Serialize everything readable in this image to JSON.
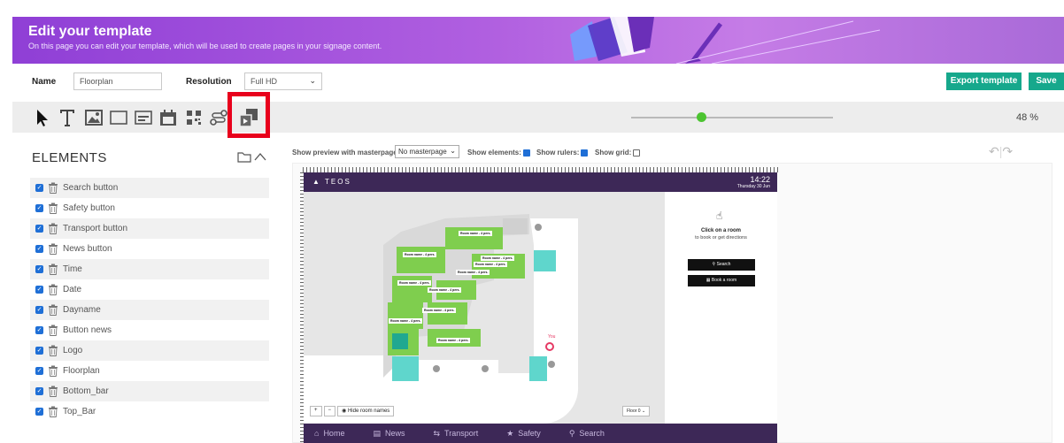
{
  "header": {
    "title": "Edit your template",
    "subtitle": "On this page you can edit your template, which will be used to create pages in your signage content."
  },
  "form": {
    "name_label": "Name",
    "name_value": "Floorplan",
    "resolution_label": "Resolution",
    "resolution_value": "Full HD"
  },
  "actions": {
    "export_label": "Export template",
    "save_label": "Save"
  },
  "toolbar": {
    "tools": [
      "pointer-icon",
      "text-icon",
      "image-icon",
      "rectangle-icon",
      "ticker-icon",
      "calendar-icon",
      "qr-code-icon",
      "route-icon",
      "media-widget-icon"
    ],
    "zoom": "48 %",
    "zoom_fraction": 0.32
  },
  "elements_panel": {
    "title": "ELEMENTS",
    "items": [
      "Search button",
      "Safety button",
      "Transport button",
      "News button",
      "Time",
      "Date",
      "Dayname",
      "Button news",
      "Logo",
      "Floorplan",
      "Bottom_bar",
      "Top_Bar"
    ]
  },
  "preview_options": {
    "masterpage_label": "Show preview with masterpage:",
    "masterpage_value": "No masterpage",
    "show_elements_label": "Show elements:",
    "show_rulers_label": "Show rulers:",
    "show_grid_label": "Show grid:"
  },
  "screen": {
    "logo_text": "TEOS",
    "time": "14:22",
    "dayname": "Thursday 30 Jun",
    "click_title": "Click on a room",
    "click_sub": "to book or get directions",
    "search_btn": "Search",
    "book_btn": "Book a room",
    "hide_room_names": "Hide room names",
    "floor": "Floor 0",
    "you_label": "You",
    "room_label": "Room name - 4 pers.",
    "bottom_nav": [
      "Home",
      "News",
      "Transport",
      "Safety",
      "Search"
    ]
  },
  "colors": {
    "accent": "#16a88c",
    "highlight": "#e8001c",
    "top_bar": "#3d2857",
    "room_green": "#7fce4e",
    "room_teal": "#5fd6cc"
  }
}
